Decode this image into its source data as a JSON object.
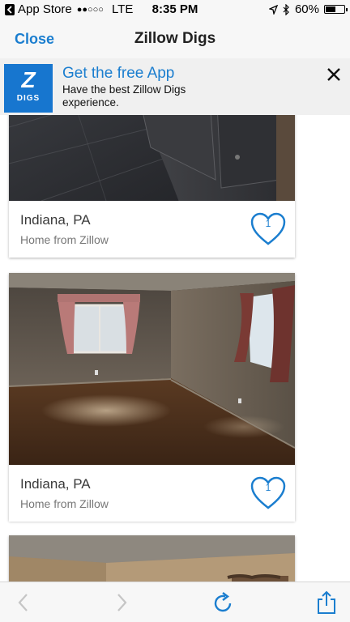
{
  "status_bar": {
    "carrier": "App Store",
    "signal": "●●○○○",
    "network": "LTE",
    "time": "8:35 PM",
    "battery": "60%",
    "battery_level": 0.6
  },
  "nav": {
    "close_label": "Close",
    "title": "Zillow Digs"
  },
  "banner": {
    "logo_text": "DIGS",
    "title": "Get the free App",
    "subtitle": "Have the best Zillow Digs experience."
  },
  "cards": [
    {
      "city": "Indiana, PA",
      "subtitle": "Home from Zillow",
      "likes": "1"
    },
    {
      "city": "Indiana, PA",
      "subtitle": "Home from Zillow",
      "likes": "1"
    }
  ],
  "colors": {
    "accent": "#1b7ecf",
    "banner_logo": "#1776cf"
  },
  "icons": [
    "back-arrow-icon",
    "forward-arrow-icon",
    "reload-icon",
    "share-icon",
    "heart-icon",
    "close-icon",
    "location-arrow-icon",
    "bluetooth-icon"
  ]
}
